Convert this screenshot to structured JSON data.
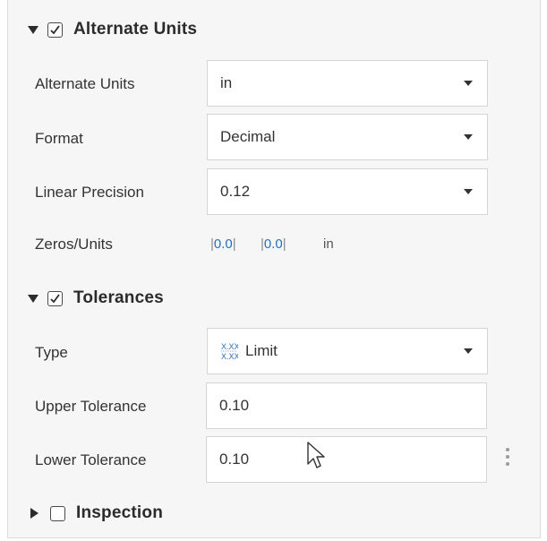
{
  "alternate_units_section": {
    "title": "Alternate Units",
    "checked": true,
    "expanded": true,
    "rows": {
      "alternate_units": {
        "label": "Alternate Units",
        "value": "in"
      },
      "format": {
        "label": "Format",
        "value": "Decimal"
      },
      "linear_precision": {
        "label": "Linear Precision",
        "value": "0.12"
      },
      "zeros_units": {
        "label": "Zeros/Units",
        "value1": "0.0",
        "value2": "0.0",
        "unit": "in"
      }
    }
  },
  "tolerances_section": {
    "title": "Tolerances",
    "checked": true,
    "expanded": true,
    "rows": {
      "type": {
        "label": "Type",
        "value": "Limit",
        "icon": "limit-tolerance-icon"
      },
      "upper_tolerance": {
        "label": "Upper Tolerance",
        "value": "0.10"
      },
      "lower_tolerance": {
        "label": "Lower Tolerance",
        "value": "0.10"
      }
    }
  },
  "inspection_section": {
    "title": "Inspection",
    "checked": false,
    "expanded": false
  },
  "colors": {
    "panel_bg": "#f6f6f6",
    "field_bg": "#ffffff",
    "accent_blue": "#2a6ebb"
  }
}
